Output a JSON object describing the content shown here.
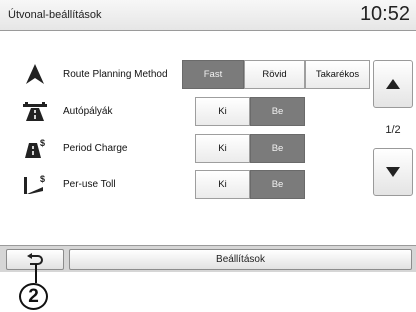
{
  "header": {
    "title": "Útvonal-beállítások",
    "time": "10:52"
  },
  "rows": [
    {
      "icon": "route-arrow-icon",
      "label": "Route Planning Method",
      "options": [
        {
          "label": "Fast",
          "selected": true
        },
        {
          "label": "Rövid",
          "selected": false
        },
        {
          "label": "Takarékos",
          "selected": false
        }
      ]
    },
    {
      "icon": "motorway-icon",
      "label": "Autópályák",
      "options": [
        {
          "label": "Ki",
          "selected": false
        },
        {
          "label": "Be",
          "selected": true
        }
      ]
    },
    {
      "icon": "period-charge-icon",
      "label": "Period Charge",
      "options": [
        {
          "label": "Ki",
          "selected": false
        },
        {
          "label": "Be",
          "selected": true
        }
      ]
    },
    {
      "icon": "toll-road-icon",
      "label": "Per-use Toll",
      "options": [
        {
          "label": "Ki",
          "selected": false
        },
        {
          "label": "Be",
          "selected": true
        }
      ]
    }
  ],
  "pager": {
    "indicator": "1/2",
    "up_icon": "arrow-up-icon",
    "down_icon": "arrow-down-icon"
  },
  "bottom_bar": {
    "back_icon": "back-arrow-icon",
    "menu_label": "Beállítások"
  },
  "callout": {
    "number": "2"
  },
  "colors": {
    "selected": "#7b7b7b",
    "unselected": "#f5f5f5",
    "header": "#eeeeee",
    "bottom_bar": "#d6d6d6"
  }
}
